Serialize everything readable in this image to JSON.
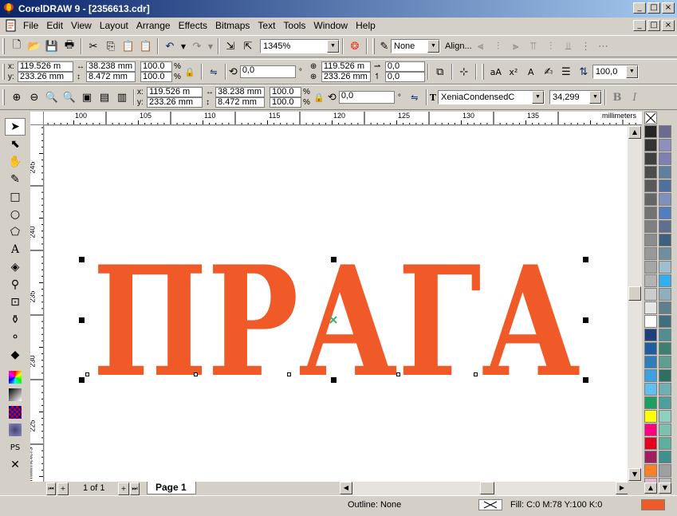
{
  "window": {
    "title": "CorelDRAW 9 - [2356613.cdr]",
    "btn_min": "_",
    "btn_max": "□",
    "btn_close": "×"
  },
  "menu": {
    "items": [
      "File",
      "Edit",
      "View",
      "Layout",
      "Arrange",
      "Effects",
      "Bitmaps",
      "Text",
      "Tools",
      "Window",
      "Help"
    ]
  },
  "standard_toolbar": {
    "zoom_level": "1345%",
    "outline_option": "None",
    "align_label": "Align..."
  },
  "property_bar_1": {
    "x_pos": "119.526 m",
    "y_pos": "233.26 mm",
    "width": "38.238 mm",
    "height": "8.472 mm",
    "scale_x": "100.0",
    "scale_y": "100.0",
    "pct": "%",
    "rotation": "0,0",
    "degree": "°",
    "center_x": "119.526 m",
    "center_y": "233.26 mm",
    "skew_h": "0,0",
    "skew_v": "0,0",
    "spacing": "100,0"
  },
  "property_bar_2": {
    "x_pos": "119.526 m",
    "y_pos": "233.26 mm",
    "width": "38.238 mm",
    "height": "8.472 mm",
    "scale_x": "100.0",
    "scale_y": "100.0",
    "pct": "%",
    "rotation": "0,0",
    "degree": "°",
    "font_name": "XeniaCondensedC",
    "font_size": "34,299",
    "bold": "B",
    "italic": "I"
  },
  "axis_labels": {
    "x": "x:",
    "y": "y:"
  },
  "ruler": {
    "h_ticks": [
      "100",
      "105",
      "110",
      "115",
      "120",
      "125",
      "130",
      "135"
    ],
    "v_ticks": [
      "245",
      "240",
      "235",
      "230",
      "225"
    ],
    "unit_h": "millimeters",
    "unit_v": "millimeters"
  },
  "canvas": {
    "text": "ПРАГА",
    "text_color": "#f05a28"
  },
  "page_nav": {
    "page_count": "1 of 1",
    "tab": "Page 1"
  },
  "status": {
    "outline": "Outline: None",
    "fill": "Fill: C:0 M:78 Y:100 K:0",
    "fill_color": "#f05a28"
  },
  "palette": {
    "col1": [
      "#262626",
      "#333333",
      "#404040",
      "#4d4d4d",
      "#595959",
      "#666666",
      "#737373",
      "#808080",
      "#8c8c8c",
      "#999999",
      "#a6a6a6",
      "#b3b3b3",
      "#cccccc",
      "#e6e6e6",
      "#ffffff",
      "#1f3f7f",
      "#1f5f9f",
      "#2f7fbf",
      "#3f9fdf",
      "#5fbfef",
      "#1f9f5f",
      "#ffff00",
      "#ff0080",
      "#e6001e",
      "#9f1f5f",
      "#ff7f27",
      "#e6b4c8"
    ],
    "col2": [
      "#6b6b8f",
      "#8f8fbf",
      "#7f7fb0",
      "#5f7fa0",
      "#4f6f9f",
      "#7f8fbf",
      "#4f7fbf",
      "#5f6f8f",
      "#3f5f7f",
      "#6f8f9f",
      "#9fbfcf",
      "#2fafef",
      "#8fafbf",
      "#5f7f8f",
      "#3f6f7f",
      "#4f8f8f",
      "#3f7f6f",
      "#5f9f8f",
      "#2f6f5f",
      "#6fafaf",
      "#4f9f9f",
      "#8fcfbf",
      "#7fbfb0",
      "#5faf9f",
      "#3f8f8f",
      "#9f9f9f",
      "#bfbfbf"
    ]
  }
}
